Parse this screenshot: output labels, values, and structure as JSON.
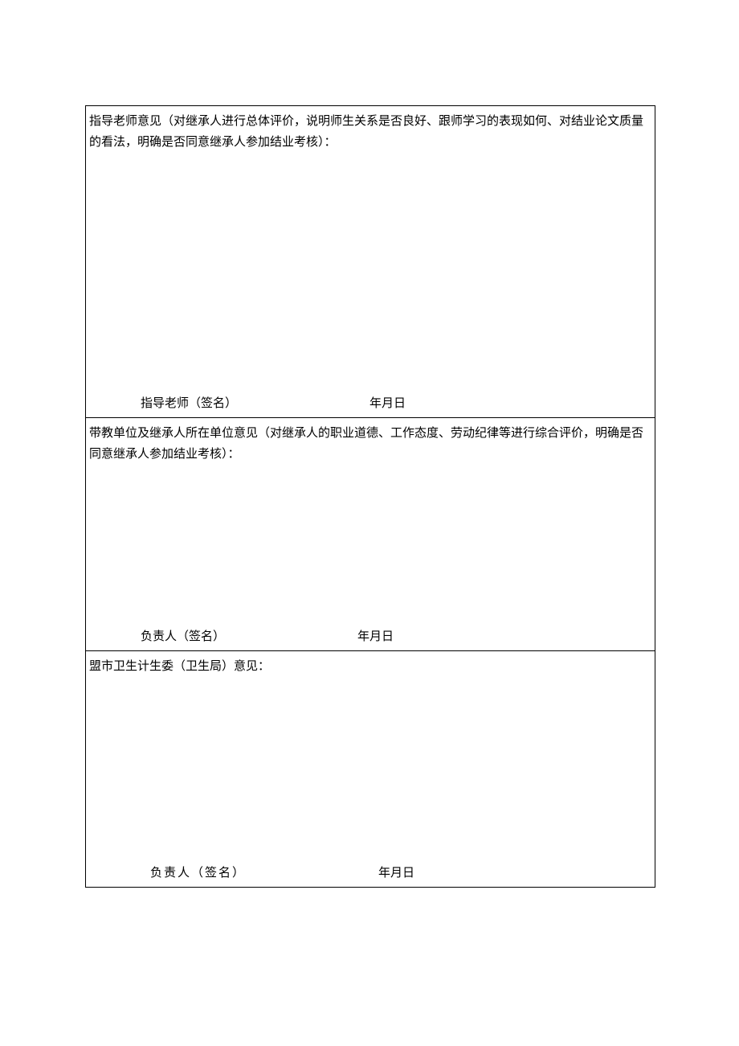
{
  "section1": {
    "heading": "指导老师意见（对继承人进行总体评价，说明师生关系是否良好、跟师学习的表现如何、对结业论文质量的看法，明确是否同意继承人参加结业考核）：",
    "signer": "指导老师（签名）",
    "date": "年月日"
  },
  "section2": {
    "heading": "带教单位及继承人所在单位意见（对继承人的职业道德、工作态度、劳动纪律等进行综合评价，明确是否同意继承人参加结业考核）：",
    "signer": "负责人（签名）",
    "date": "年月日"
  },
  "section3": {
    "heading": "盟市卫生计生委（卫生局）意见：",
    "signer": "负责人（签名）",
    "date": "年月日"
  }
}
